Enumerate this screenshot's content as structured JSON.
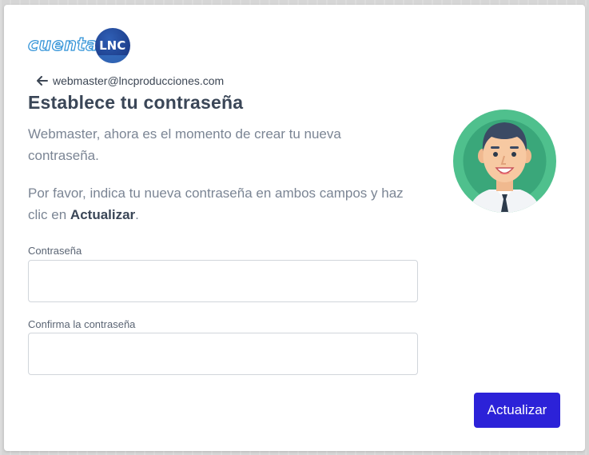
{
  "logo": {
    "text": "cuenta",
    "badge": "LNC"
  },
  "back": {
    "icon": "arrow-left-icon",
    "email": "webmaster@lncproducciones.com"
  },
  "title": "Establece tu contraseña",
  "intro": "Webmaster, ahora es el momento de crear tu nueva contraseña.",
  "instructions": {
    "before": "Por favor, indica tu nueva contraseña en ambos campos y haz clic en ",
    "bold": "Actualizar",
    "after": "."
  },
  "form": {
    "password_label": "Contraseña",
    "password_value": "",
    "confirm_label": "Confirma la contraseña",
    "confirm_value": ""
  },
  "submit_label": "Actualizar",
  "colors": {
    "primary": "#2c22d8",
    "avatar_ring": "#4fc08d"
  }
}
